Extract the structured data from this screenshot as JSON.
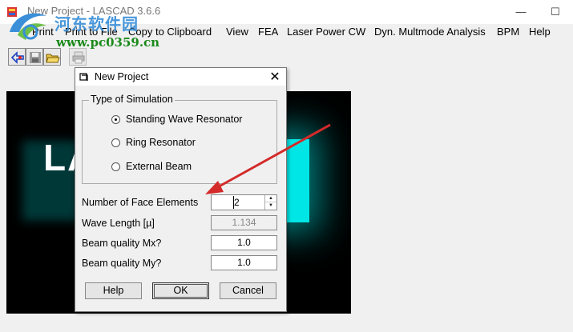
{
  "window": {
    "title": "New Project - LASCAD 3.6.6",
    "minimize_glyph": "—",
    "maximize_glyph": "☐"
  },
  "watermark": {
    "name_cn": "河东软件园",
    "url": "www.pc0359.cn"
  },
  "menu": [
    "Print",
    "Print to File",
    "Copy to Clipboard",
    "View",
    "FEA",
    "Laser Power CW",
    "Dyn. Multmode Analysis",
    "BPM",
    "Help"
  ],
  "toolbar": {
    "icons": [
      "new-project-icon",
      "save-icon",
      "open-folder-icon",
      "print-icon"
    ]
  },
  "canvas": {
    "letters": "LA"
  },
  "dialog": {
    "title": "New Project",
    "close_glyph": "✕",
    "group_title": "Type of Simulation",
    "options": [
      {
        "label": "Standing Wave Resonator",
        "checked": true
      },
      {
        "label": "Ring Resonator",
        "checked": false
      },
      {
        "label": "External Beam",
        "checked": false
      }
    ],
    "fields": {
      "face_elements_label": "Number of Face Elements",
      "face_elements_value": "2",
      "wave_length_label": "Wave Length [µ]",
      "wave_length_value": "1.134",
      "mx_label": "Beam quality Mx?",
      "mx_value": "1.0",
      "my_label": "Beam quality My?",
      "my_value": "1.0"
    },
    "buttons": {
      "help": "Help",
      "ok": "OK",
      "cancel": "Cancel"
    }
  },
  "colors": {
    "arrow": "#d42a2a",
    "glow": "#00e6e6",
    "watermark_blue": "#3a8fd8",
    "watermark_green": "#1b8a1b"
  }
}
